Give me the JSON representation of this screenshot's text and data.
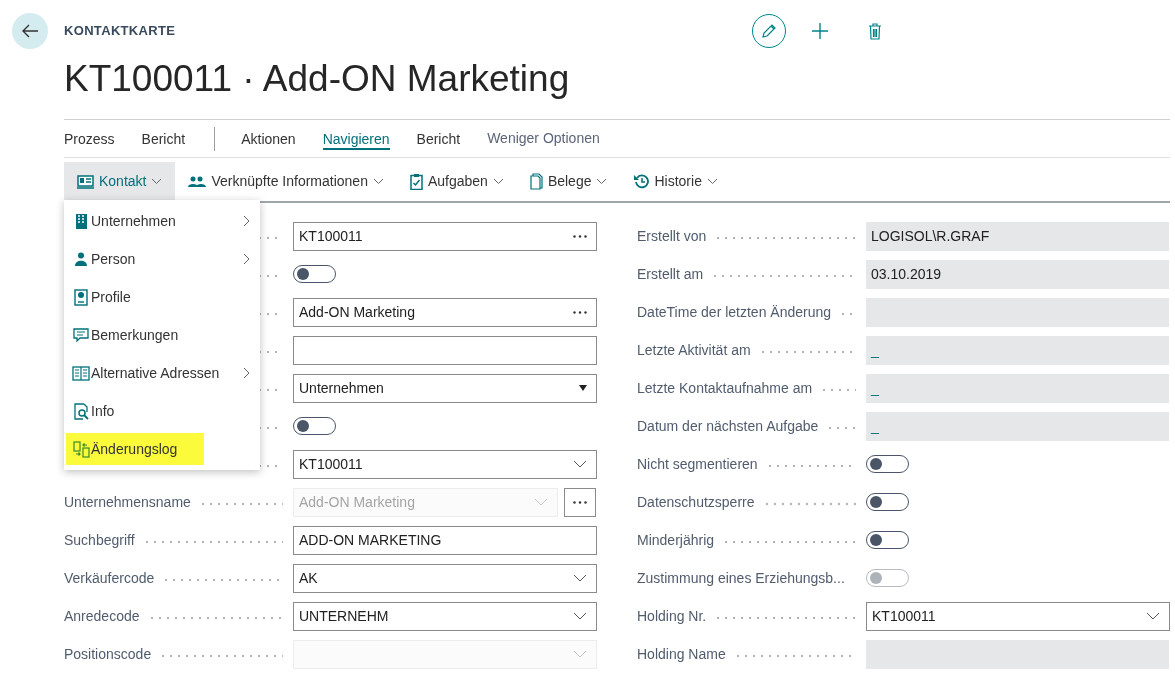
{
  "header": {
    "caption": "KONTAKTKARTE",
    "title": "KT100011 · Add-ON Marketing"
  },
  "tab_groups": [
    [
      {
        "label": "Prozess",
        "selected": false
      },
      {
        "label": "Bericht",
        "selected": false
      }
    ],
    [
      {
        "label": "Aktionen",
        "selected": false
      },
      {
        "label": "Navigieren",
        "selected": true
      },
      {
        "label": "Bericht",
        "selected": false
      }
    ]
  ],
  "more_link": "Weniger Optionen",
  "actions": [
    {
      "label": "Kontakt",
      "expanded": true
    },
    {
      "label": "Verknüpfte Informationen",
      "expanded": false
    },
    {
      "label": "Aufgaben",
      "expanded": false
    },
    {
      "label": "Belege",
      "expanded": false
    },
    {
      "label": "Historie",
      "expanded": false
    }
  ],
  "menu": [
    {
      "label": "Unternehmen",
      "submenu": true,
      "highlighted": false
    },
    {
      "label": "Person",
      "submenu": true,
      "highlighted": false
    },
    {
      "label": "Profile",
      "submenu": false,
      "highlighted": false
    },
    {
      "label": "Bemerkungen",
      "submenu": false,
      "highlighted": false
    },
    {
      "label": "Alternative Adressen",
      "submenu": true,
      "highlighted": false
    },
    {
      "label": "Info",
      "submenu": false,
      "highlighted": false
    },
    {
      "label": "Änderungslog",
      "submenu": false,
      "highlighted": true
    }
  ],
  "left_fields": [
    {
      "kind": "text",
      "value": "KT100011",
      "lookup": true
    },
    {
      "kind": "toggle",
      "on": false,
      "disabled": false
    },
    {
      "kind": "text",
      "value": "Add-ON Marketing",
      "lookup": true
    },
    {
      "kind": "text"
    },
    {
      "kind": "select",
      "value": "Unternehmen"
    },
    {
      "kind": "toggle",
      "on": false,
      "disabled": false
    },
    {
      "kind": "dropdown",
      "value": "KT100011",
      "disabled": false
    },
    {
      "label": "Unternehmensname",
      "kind": "dropdown",
      "value": "Add-ON Marketing",
      "disabled": true,
      "lookup": true
    },
    {
      "label": "Suchbegriff",
      "kind": "text",
      "value": "ADD-ON MARKETING"
    },
    {
      "label": "Verkäufercode",
      "kind": "dropdown",
      "value": "AK",
      "disabled": false
    },
    {
      "label": "Anredecode",
      "kind": "dropdown",
      "value": "UNTERNEHM",
      "disabled": false
    },
    {
      "label": "Positionscode",
      "kind": "dropdown",
      "disabled": true
    }
  ],
  "right_fields": [
    {
      "label": "Erstellt von",
      "kind": "readonly",
      "value": "LOGISOL\\R.GRAF"
    },
    {
      "label": "Erstellt am",
      "kind": "readonly",
      "value": "03.10.2019"
    },
    {
      "label": "DateTime der letzten Änderung",
      "kind": "readonly"
    },
    {
      "label": "Letzte Aktivität am",
      "kind": "readonly",
      "value": "_"
    },
    {
      "label": "Letzte Kontaktaufnahme am",
      "kind": "readonly",
      "value": "_"
    },
    {
      "label": "Datum der nächsten Aufgabe",
      "kind": "readonly",
      "value": "_"
    },
    {
      "label": "Nicht segmentieren",
      "kind": "toggle",
      "on": false,
      "disabled": false
    },
    {
      "label": "Datenschutzsperre",
      "kind": "toggle",
      "on": false,
      "disabled": false
    },
    {
      "label": "Minderjährig",
      "kind": "toggle",
      "on": false,
      "disabled": false
    },
    {
      "label": "Zustimmung eines Erziehungsb...",
      "kind": "toggle",
      "on": false,
      "disabled": true
    },
    {
      "label": "Holding Nr.",
      "kind": "dropdown",
      "value": "KT100011",
      "disabled": false
    },
    {
      "label": "Holding Name",
      "kind": "readonly"
    }
  ]
}
